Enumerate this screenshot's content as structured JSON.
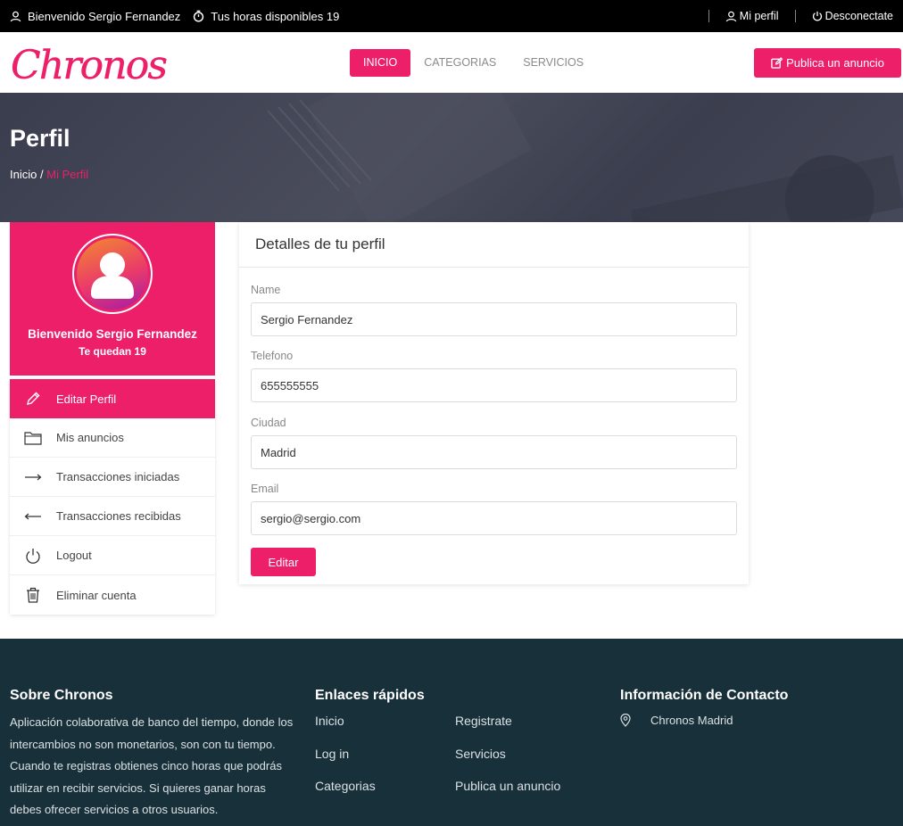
{
  "topbar": {
    "welcome": "Bienvenido Sergio Fernandez",
    "hours": "Tus horas disponibles 19",
    "profile_link": "Mi perfil",
    "logout_link": "Desconectate"
  },
  "nav": {
    "logo_text": "Chronos",
    "items": [
      "INICIO",
      "CATEGORIAS",
      "SERVICIOS"
    ],
    "publish_label": "Publica un anuncio"
  },
  "hero": {
    "title": "Perfil",
    "breadcrumb_home": "Inicio",
    "breadcrumb_sep": "/",
    "breadcrumb_current": "Mi Perfil"
  },
  "profile_card": {
    "welcome": "Bienvenido Sergio Fernandez",
    "remaining": "Te quedan 19"
  },
  "side_menu": {
    "items": [
      {
        "label": "Editar Perfil",
        "icon": "pencil-icon"
      },
      {
        "label": "Mis anuncios",
        "icon": "folder-icon"
      },
      {
        "label": "Transacciones iniciadas",
        "icon": "arrow-right-icon"
      },
      {
        "label": "Transacciones recibidas",
        "icon": "arrow-left-icon"
      },
      {
        "label": "Logout",
        "icon": "power-icon"
      },
      {
        "label": "Eliminar cuenta",
        "icon": "trash-icon"
      }
    ]
  },
  "details": {
    "title": "Detalles de tu perfil",
    "fields": [
      {
        "label": "Name",
        "value": "Sergio Fernandez"
      },
      {
        "label": "Telefono",
        "value": "655555555"
      },
      {
        "label": "Ciudad",
        "value": "Madrid"
      },
      {
        "label": "Email",
        "value": "sergio@sergio.com"
      }
    ],
    "button_label": "Editar"
  },
  "footer": {
    "about_title": "Sobre Chronos",
    "about_text": "Aplicación colaborativa de banco del tiempo, donde los intercambios no son monetarios, son con tu tiempo. Cuando te registras obtienes cinco horas que podrás utilizar en recibir servicios. Si quieres ganar horas debes ofrecer servicios a otros usuarios.",
    "links_title": "Enlaces rápidos",
    "links": [
      "Inicio",
      "Log in",
      "Categorias",
      "Registrate",
      "Servicios",
      "Publica un anuncio"
    ],
    "contact_title": "Información de Contacto",
    "contact_location": "Chronos Madrid"
  },
  "colors": {
    "accent": "#ec1f68",
    "topbar": "#000000",
    "footer": "#18303a"
  }
}
